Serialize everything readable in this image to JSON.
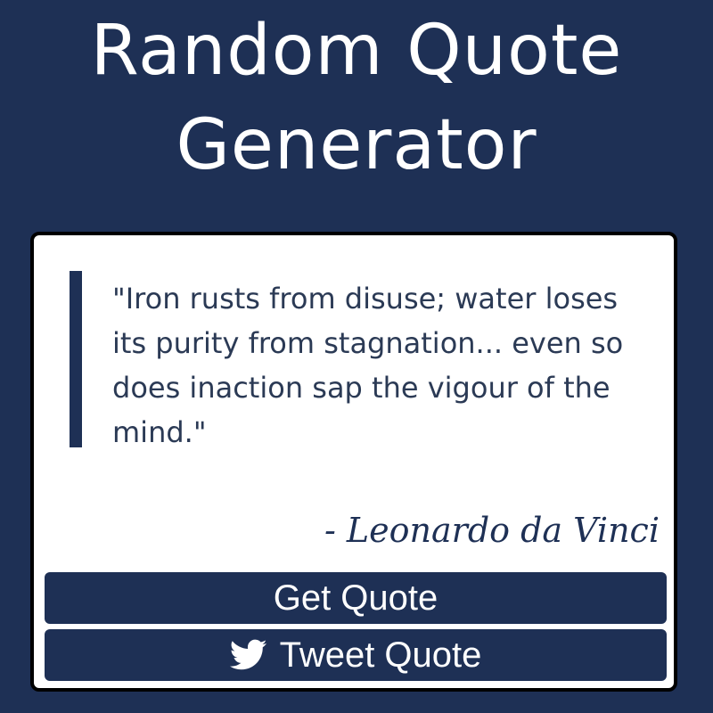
{
  "header": {
    "title_line1": "Random Quote",
    "title_line2": "Generator"
  },
  "quote": {
    "text": "\"Iron rusts from disuse; water loses its purity from stagnation... even so does inaction sap the vigour of the mind.\"",
    "author": "- Leonardo da Vinci"
  },
  "buttons": {
    "get_quote_label": "Get Quote",
    "tweet_quote_label": "Tweet Quote",
    "tweet_icon": "twitter-icon"
  },
  "colors": {
    "background": "#1e3055",
    "card": "#ffffff",
    "accent": "#1e3055",
    "button_text": "#ffffff"
  }
}
